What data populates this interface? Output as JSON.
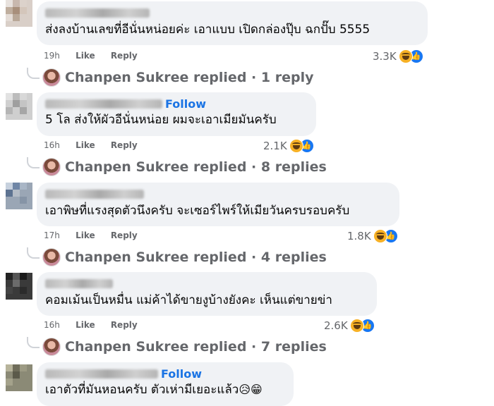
{
  "comments": [
    {
      "text": "ส่งลงบ้านเลขที่อีนั่นหน่อยค่ะ เอาแบบ เปิดกล่องปุ๊บ ฉกปั๊บ 5555",
      "time": "19h",
      "like_label": "Like",
      "reply_label": "Reply",
      "reactions": "3.3K",
      "follow": "",
      "replied_by": "Chanpen Sukree replied",
      "replies": "· 1 reply"
    },
    {
      "text": "5 โล ส่งให้ผัวอีนั่นหน่อย ผมจะเอาเมียมันครับ",
      "time": "16h",
      "like_label": "Like",
      "reply_label": "Reply",
      "reactions": "2.1K",
      "follow": "Follow",
      "replied_by": "Chanpen Sukree replied",
      "replies": "· 8 replies"
    },
    {
      "text": "เอาพิษที่แรงสุดตัวนึงครับ จะเซอร์ไพร์ให้เมียวันครบรอบครับ",
      "time": "17h",
      "like_label": "Like",
      "reply_label": "Reply",
      "reactions": "1.8K",
      "follow": "",
      "replied_by": "Chanpen Sukree replied",
      "replies": "· 4 replies"
    },
    {
      "text": "คอมเม้นเป็นหมื่น แม่ค้าได้ขายงูบ้างยังคะ เห็นแต่ขายข่า",
      "time": "16h",
      "like_label": "Like",
      "reply_label": "Reply",
      "reactions": "2.6K",
      "follow": "",
      "replied_by": "Chanpen Sukree replied",
      "replies": "· 7 replies"
    },
    {
      "text": "เอาตัวที่มันหอนครับ ตัวเห่ามีเยอะแล้ว",
      "emoji": "😥😁",
      "follow": "Follow"
    }
  ],
  "colors": {
    "link_blue": "#1b74e4",
    "bubble_bg": "#f0f2f5",
    "meta_gray": "#65676b"
  },
  "icons": [
    "haha-reaction-icon",
    "like-reaction-icon",
    "replier-avatar"
  ]
}
